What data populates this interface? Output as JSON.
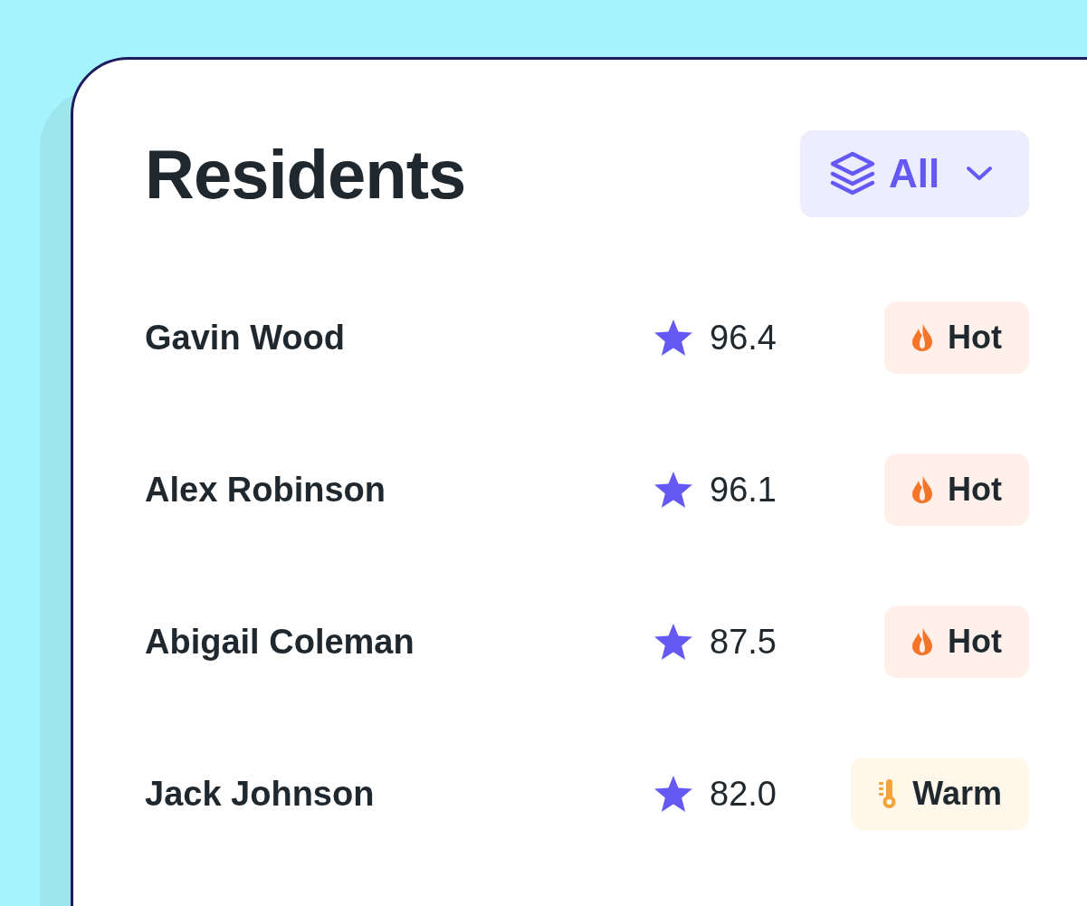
{
  "title": "Residents",
  "filter": {
    "label": "All"
  },
  "residents": [
    {
      "name": "Gavin Wood",
      "score": "96.4",
      "status": {
        "kind": "hot",
        "label": "Hot"
      }
    },
    {
      "name": "Alex Robinson",
      "score": "96.1",
      "status": {
        "kind": "hot",
        "label": "Hot"
      }
    },
    {
      "name": "Abigail Coleman",
      "score": "87.5",
      "status": {
        "kind": "hot",
        "label": "Hot"
      }
    },
    {
      "name": "Jack Johnson",
      "score": "82.0",
      "status": {
        "kind": "warm",
        "label": "Warm"
      }
    }
  ]
}
